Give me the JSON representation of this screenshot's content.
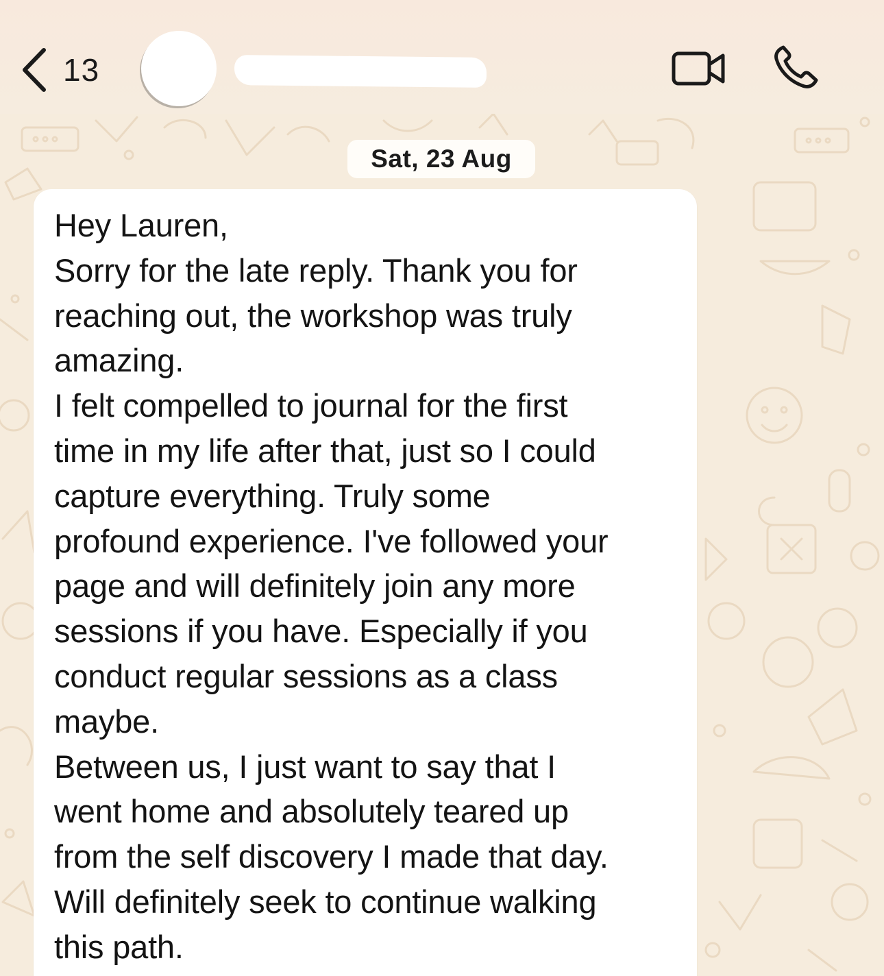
{
  "header": {
    "back_count": "13",
    "icons": {
      "back": "chevron-left-icon",
      "video": "video-camera-icon",
      "call": "phone-icon"
    }
  },
  "chat": {
    "date_label": "Sat, 23 Aug",
    "message": {
      "text": "Hey Lauren,\nSorry for the late reply. Thank you for\nreaching out, the workshop was truly\namazing.\nI felt compelled to journal for the first\ntime in my life after that, just so I could\ncapture everything. Truly some\nprofound experience. I've followed your\npage and will definitely join any more\nsessions if you have. Especially if you\nconduct regular sessions as a class\nmaybe.\nBetween us, I just want to say that I\nwent home and absolutely teared up\nfrom the self discovery I made that day.\nWill definitely seek to continue walking\nthis path."
    }
  },
  "colors": {
    "header_bg": "#f8e9dd",
    "chat_bg": "#f6ecdd",
    "bubble_bg": "#ffffff",
    "text": "#141414"
  }
}
